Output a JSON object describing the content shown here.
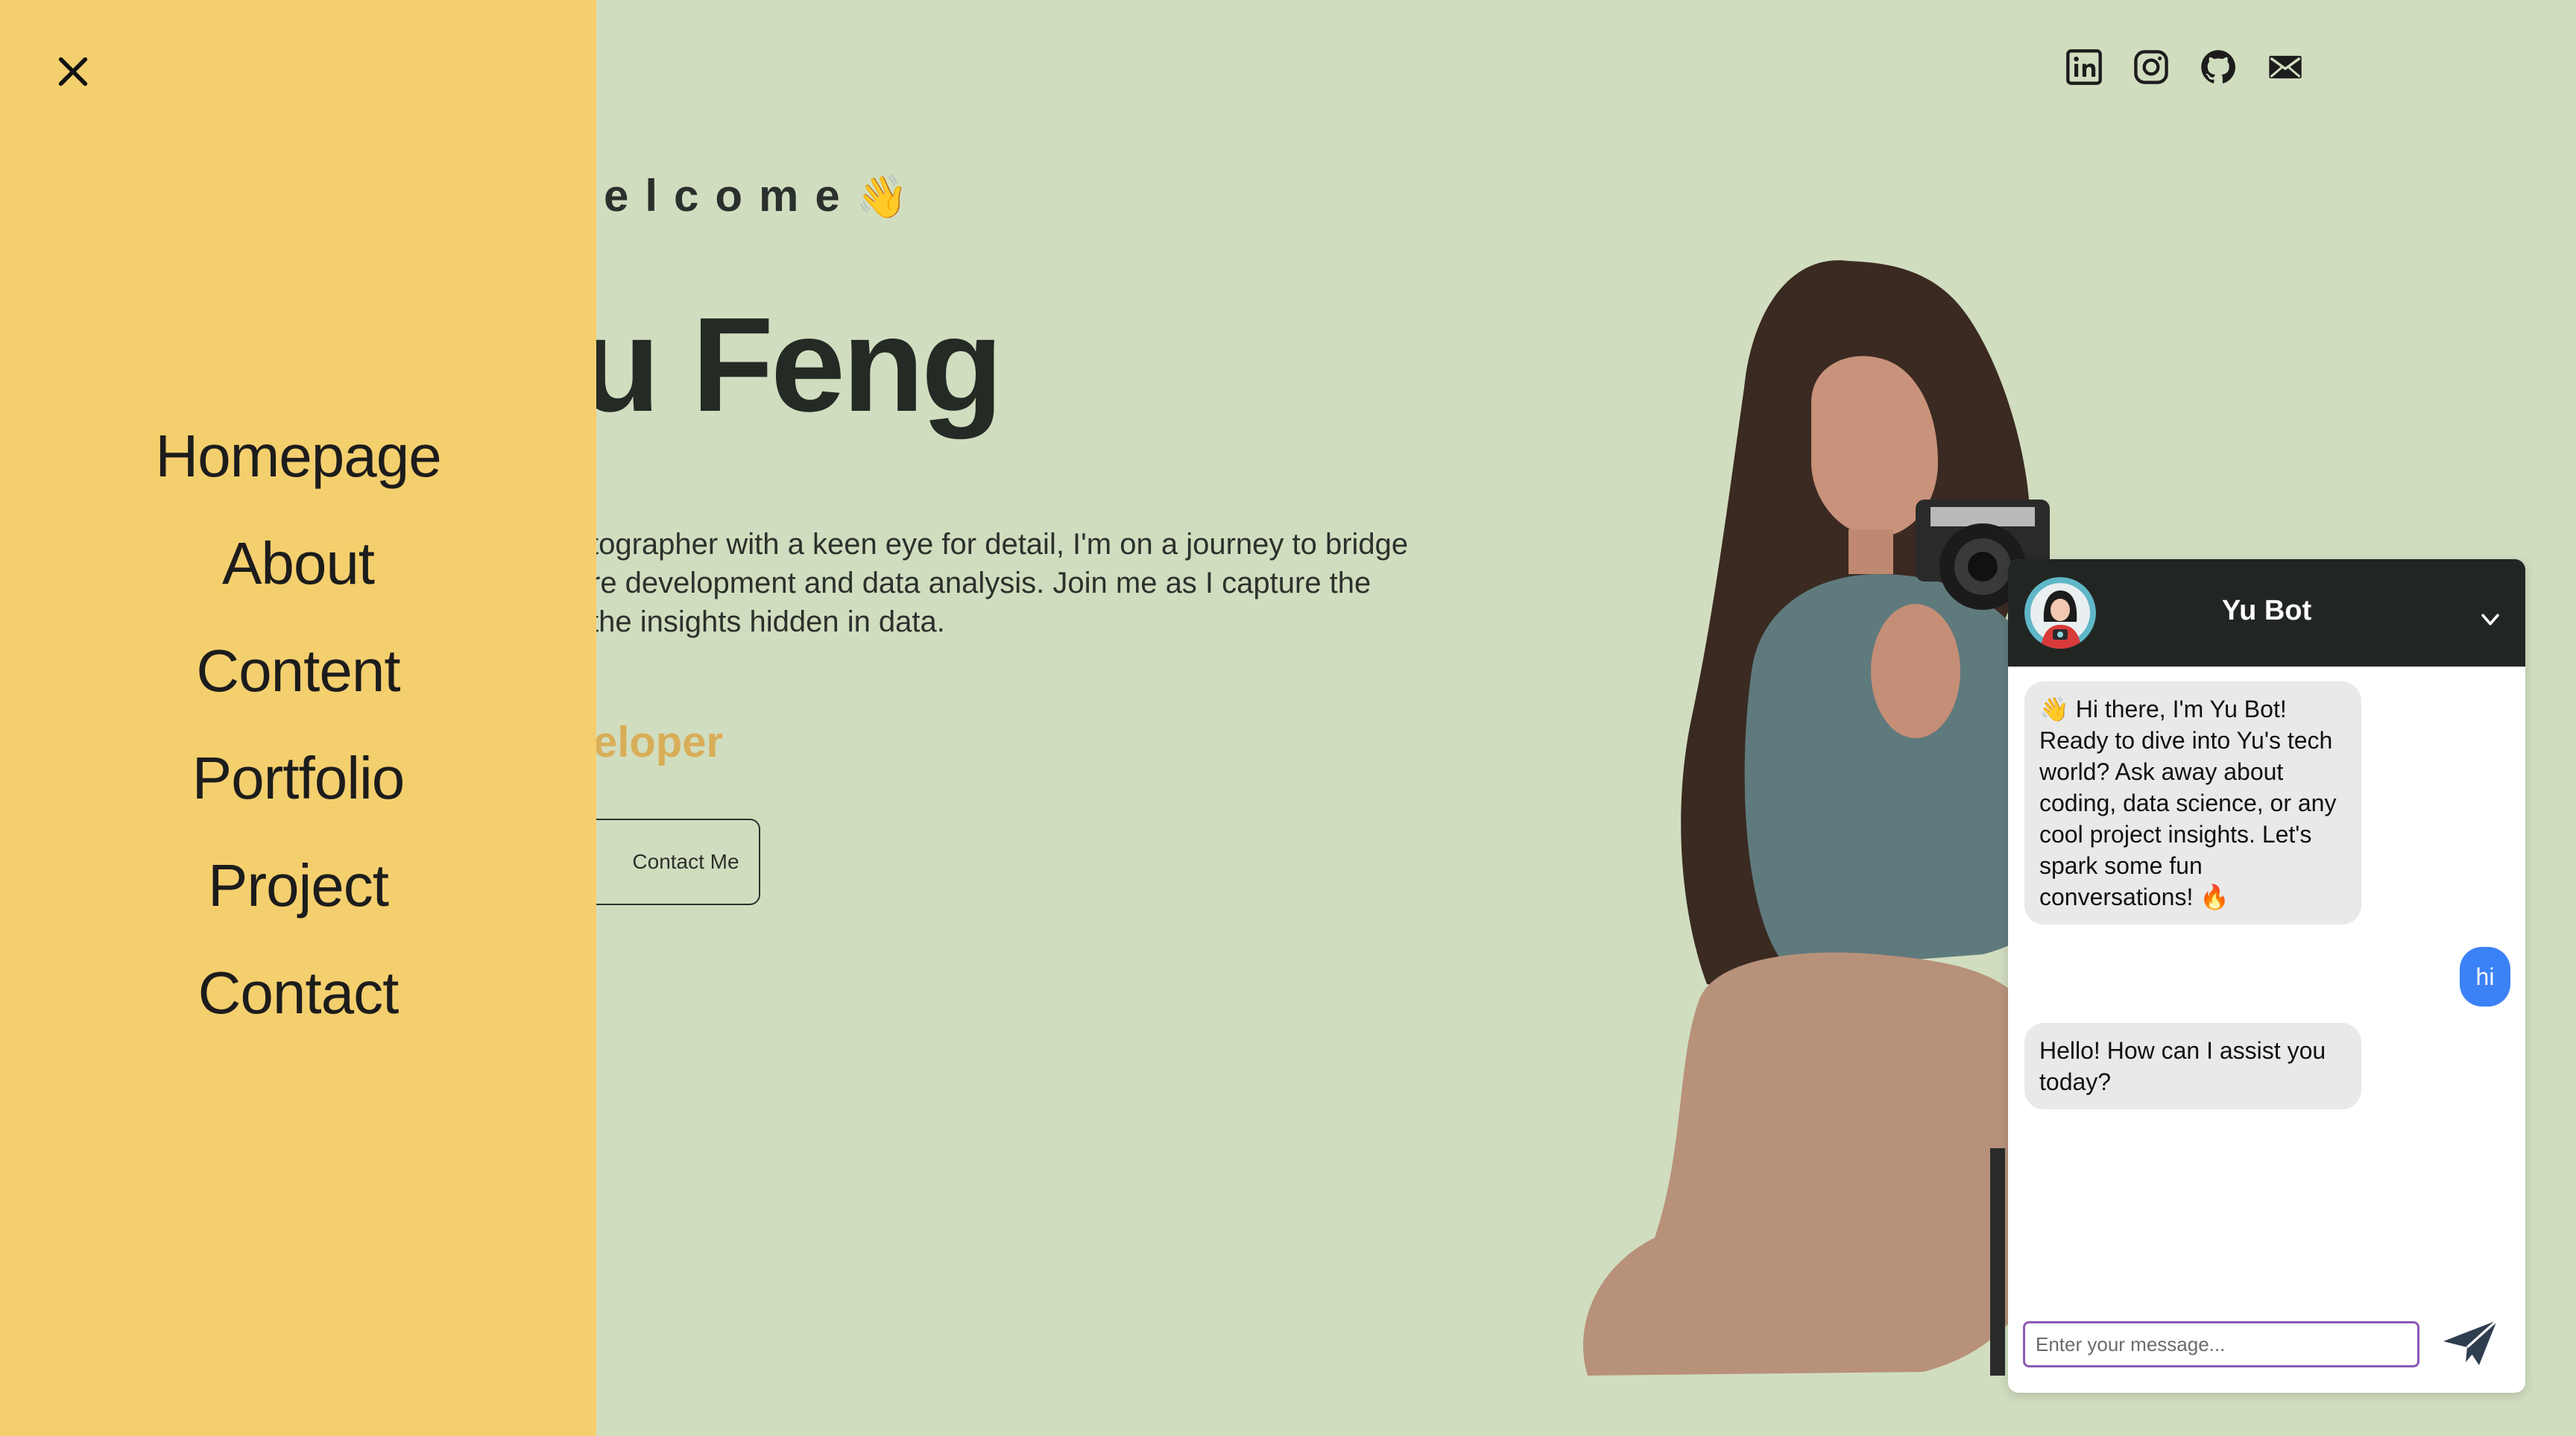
{
  "hero": {
    "welcome": "elcome",
    "wave_emoji": "👋",
    "name": "u Feng",
    "bio_lines": [
      "tographer with a keen eye for detail, I'm on a journey to bridge",
      "re development and data analysis. Join me as I capture the",
      "the insights hidden in data."
    ],
    "role": "eloper",
    "contact_button": "Contact Me"
  },
  "socials": [
    {
      "icon": "linkedin-icon"
    },
    {
      "icon": "instagram-icon"
    },
    {
      "icon": "github-icon"
    },
    {
      "icon": "mail-icon"
    }
  ],
  "drawer": {
    "close_icon": "close-icon",
    "menu": [
      "Homepage",
      "About",
      "Content",
      "Portfolio",
      "Project",
      "Contact"
    ]
  },
  "chat": {
    "title": "Yu Bot",
    "messages": [
      {
        "from": "bot",
        "text": "👋 Hi there, I'm Yu Bot! Ready to dive into Yu's tech world? Ask away about coding, data science, or any cool project insights. Let's spark some fun conversations! 🔥"
      },
      {
        "from": "user",
        "text": "hi"
      },
      {
        "from": "bot",
        "text": "Hello! How can I assist you today?"
      }
    ],
    "input_placeholder": "Enter your message..."
  },
  "colors": {
    "background": "#d1ddbf",
    "drawer": "#f4cf6e",
    "accent_role": "#d8ae58",
    "chat_header": "#222623",
    "user_bubble": "#3b82f6",
    "input_border": "#8d5ab3"
  }
}
